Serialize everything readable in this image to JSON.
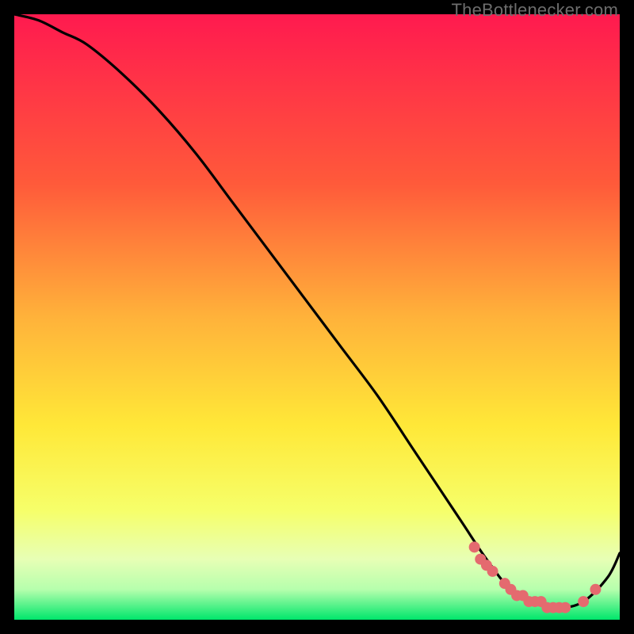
{
  "watermark": "TheBottlenecker.com",
  "colors": {
    "gradient_top": "#ff1a4f",
    "gradient_mid1": "#ff7a2a",
    "gradient_mid2": "#ffe838",
    "gradient_mid3": "#f4ff70",
    "gradient_bottom": "#00e66b",
    "curve": "#000000",
    "markers": "#e46a6f"
  },
  "chart_data": {
    "type": "line",
    "title": "",
    "xlabel": "",
    "ylabel": "",
    "xlim": [
      0,
      100
    ],
    "ylim": [
      0,
      100
    ],
    "series": [
      {
        "name": "bottleneck-curve",
        "x": [
          0,
          4,
          8,
          12,
          18,
          24,
          30,
          36,
          42,
          48,
          54,
          60,
          66,
          70,
          74,
          78,
          82,
          86,
          90,
          94,
          98,
          100
        ],
        "y": [
          100,
          99,
          97,
          95,
          90,
          84,
          77,
          69,
          61,
          53,
          45,
          37,
          28,
          22,
          16,
          10,
          5,
          3,
          2,
          3,
          7,
          11
        ]
      }
    ],
    "markers": {
      "name": "sweet-spot",
      "x": [
        76,
        77,
        78,
        79,
        81,
        82,
        83,
        84,
        85,
        86,
        87,
        88,
        89,
        90,
        91,
        94,
        96
      ],
      "y": [
        12,
        10,
        9,
        8,
        6,
        5,
        4,
        4,
        3,
        3,
        3,
        2,
        2,
        2,
        2,
        3,
        5
      ]
    }
  }
}
